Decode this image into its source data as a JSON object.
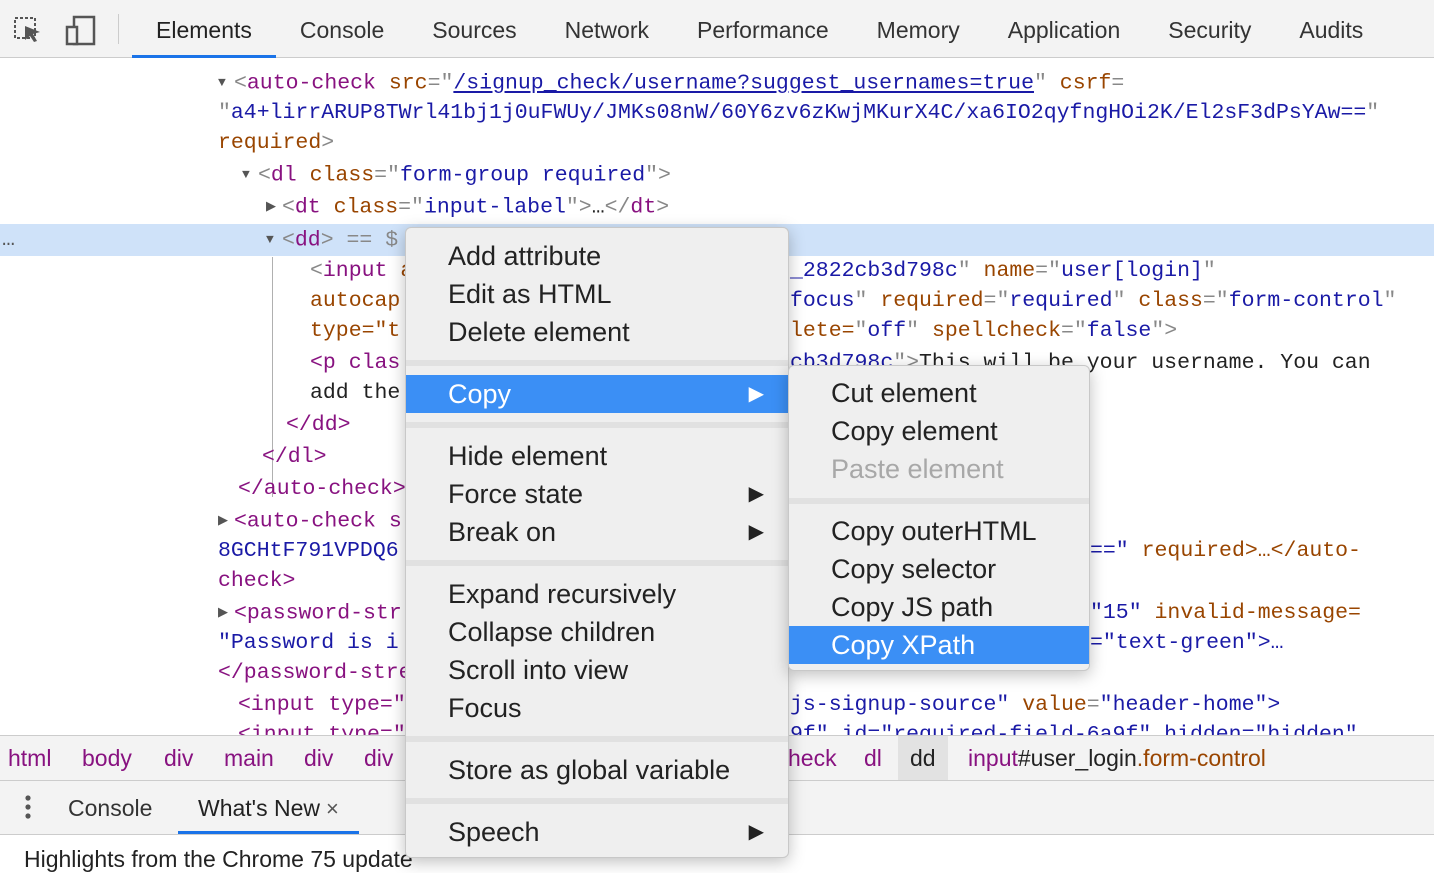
{
  "tabs": [
    "Elements",
    "Console",
    "Sources",
    "Network",
    "Performance",
    "Memory",
    "Application",
    "Security",
    "Audits"
  ],
  "active_tab": "Elements",
  "code": {
    "auto_check_tag": "auto-check",
    "src_attr": "src",
    "src_value": "/signup_check/username?suggest_usernames=true",
    "csrf_attr": "csrf",
    "csrf_value": "a4+lirrARUP8TWrl41bj1j0uFWUy/JMKs08nW/60Y6zv6zKwjMKurX4C/xa6IO2qyfngHOi2K/El2sF3dPsYAw==",
    "required_attr": "required",
    "dl_tag": "dl",
    "class_attr": "class",
    "dl_class": "form-group required",
    "dt_tag": "dt",
    "dt_class": "input-label",
    "ellipsis": "…",
    "dd_tag": "dd",
    "dd_marker": " == $",
    "row_dots": "…",
    "input_tag": "input",
    "id_fragment": "_2822cb3d798c",
    "name_attr": "name",
    "name_value": "user[login]",
    "autocap_fragment": "autocap",
    "focus_fragment": "focus",
    "required_value": "required",
    "form_control": "form-control",
    "type_fragment": "type=\"t",
    "autocomplete_fragment": "lete=",
    "off_value": "off",
    "spellcheck_attr": "spellcheck",
    "false_value": "false",
    "p_fragment": "<p clas",
    "p_id_fragment": "cb3d798c",
    "username_text": "This will be your username. You can",
    "add_the": "add the",
    "close_dd": "</dd>",
    "close_dl": "</dl>",
    "close_auto_check": "</auto-check>",
    "auto_check_s": "<auto-check s",
    "csrf2_fragment": "8GCHtF791VPDQ6",
    "csrf2_end": "==\"",
    "required_ellipsis": "required>…</auto-",
    "check_close": "check>",
    "password_str": "<password-str",
    "fifteen": "\"15\"",
    "invalid_message": "invalid-message=",
    "password_is": "\"Password is i",
    "text_green": "=\"text-green\">…",
    "close_password": "</password-stre",
    "input_type": "<input type=\"",
    "signup_source": "js-signup-source\"",
    "value_attr": "value",
    "header_home": "\"header-home\">",
    "partial_line_left": "<input type=\"",
    "partial_line_right": "9f\" id=\"required-field-6a9f\" hidden=\"hidden\""
  },
  "breadcrumbs": {
    "items": [
      "html",
      "body",
      "div",
      "main",
      "div",
      "div",
      "heck",
      "dl"
    ],
    "selected": "dd",
    "last_tag": "input",
    "last_id": "#user_login",
    "last_class": ".form-control"
  },
  "drawer": {
    "menu_icon": "vertical-dots-icon",
    "tabs": [
      "Console",
      "What's New"
    ],
    "active": "What's New",
    "close_glyph": "×",
    "whats_new_text": "Highlights from the Chrome 75 update"
  },
  "context_menu": {
    "items": [
      "Add attribute",
      "Edit as HTML",
      "Delete element",
      "Copy",
      "Hide element",
      "Force state",
      "Break on",
      "Expand recursively",
      "Collapse children",
      "Scroll into view",
      "Focus",
      "Store as global variable",
      "Speech"
    ],
    "highlighted": "Copy",
    "submenu_arrow": "▶"
  },
  "copy_submenu": {
    "items": [
      "Cut element",
      "Copy element",
      "Paste element",
      "Copy outerHTML",
      "Copy selector",
      "Copy JS path",
      "Copy XPath"
    ],
    "disabled": "Paste element",
    "highlighted": "Copy XPath"
  },
  "colors": {
    "tag": "#881280",
    "attr_name": "#994500",
    "attr_value": "#1a1aa6",
    "selection": "#cfe2f9",
    "menu_highlight": "#3b8ff5",
    "active_tab_underline": "#1a73e8"
  }
}
